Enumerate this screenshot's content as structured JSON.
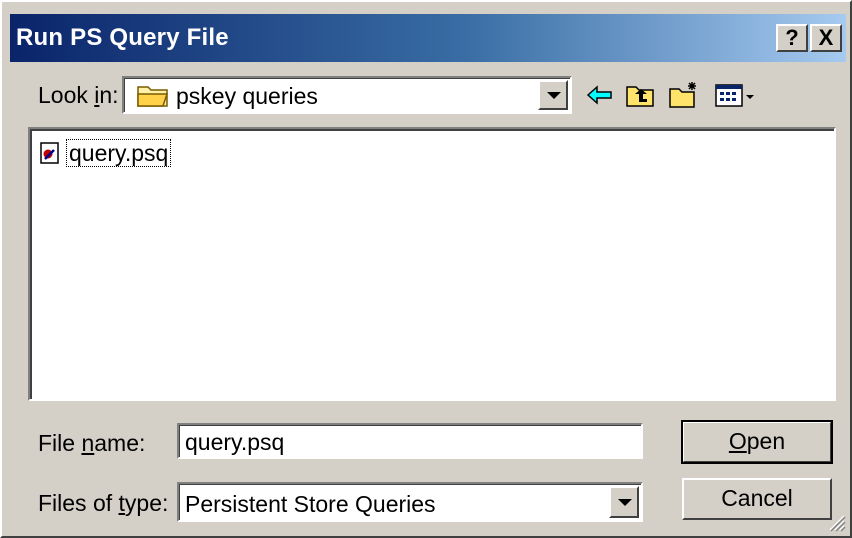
{
  "window": {
    "title": "Run PS Query File",
    "help_label": "?",
    "close_label": "X"
  },
  "look_in": {
    "label_pre": "Look ",
    "label_key": "i",
    "label_post": "n:",
    "value": "pskey queries",
    "icon": "folder-icon"
  },
  "toolbar": {
    "icons": [
      "back-arrow-icon",
      "up-folder-icon",
      "new-folder-icon",
      "view-menu-icon"
    ]
  },
  "files": [
    {
      "name": "query.psq",
      "icon": "psq-file-icon"
    }
  ],
  "file_name": {
    "label_pre": "File ",
    "label_key": "n",
    "label_post": "ame:",
    "value": "query.psq"
  },
  "file_type": {
    "label_pre": "Files of ",
    "label_key": "t",
    "label_post": "ype:",
    "value": "Persistent Store Queries"
  },
  "buttons": {
    "open_key": "O",
    "open_rest": "pen",
    "cancel": "Cancel"
  },
  "colors": {
    "title_start": "#0a246a",
    "title_end": "#a6caf0",
    "face": "#d4d0c8"
  }
}
